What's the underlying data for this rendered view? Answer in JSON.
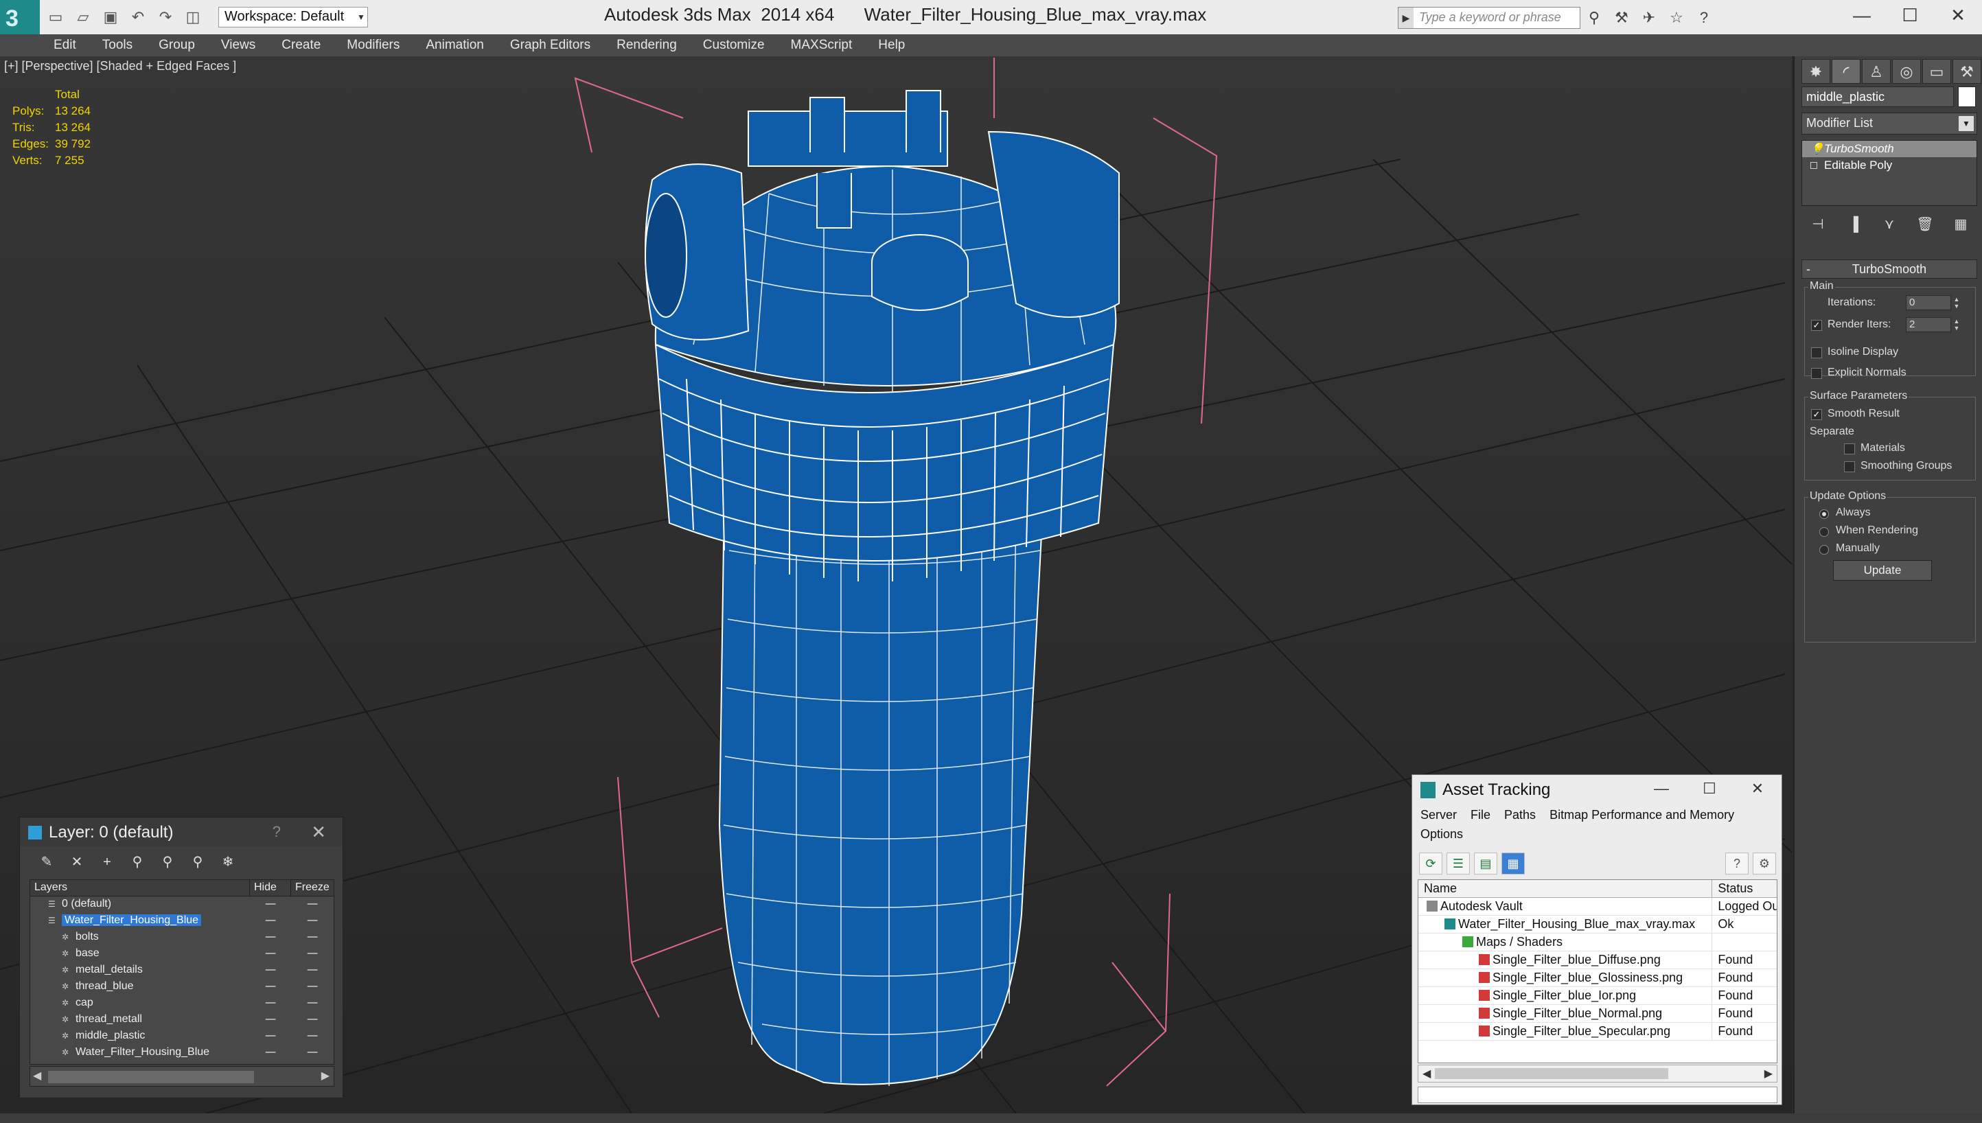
{
  "app": {
    "title": "Autodesk 3ds Max  2014 x64      Water_Filter_Housing_Blue_max_vray.max",
    "workspace_label": "Workspace: Default",
    "search_placeholder": "Type a keyword or phrase"
  },
  "menu": [
    "Edit",
    "Tools",
    "Group",
    "Views",
    "Create",
    "Modifiers",
    "Animation",
    "Graph Editors",
    "Rendering",
    "Customize",
    "MAXScript",
    "Help"
  ],
  "viewport": {
    "label": "[+] [Perspective] [Shaded + Edged Faces ]",
    "stats_header": "Total",
    "stats": [
      {
        "k": "Polys:",
        "v": "13 264"
      },
      {
        "k": "Tris:",
        "v": "13 264"
      },
      {
        "k": "Edges:",
        "v": "39 792"
      },
      {
        "k": "Verts:",
        "v": "7 255"
      }
    ]
  },
  "command_panel": {
    "object_name": "middle_plastic",
    "modifier_list": "Modifier List",
    "stack": [
      {
        "label": "TurboSmooth",
        "selected": true
      },
      {
        "label": "Editable Poly",
        "selected": false
      }
    ],
    "rollout_title": "TurboSmooth",
    "main_label": "Main",
    "iterations_label": "Iterations:",
    "iterations_value": "0",
    "render_iters_label": "Render Iters:",
    "render_iters_value": "2",
    "isoline_label": "Isoline Display",
    "explicit_normals_label": "Explicit Normals",
    "surface_params_label": "Surface Parameters",
    "smooth_result_label": "Smooth Result",
    "separate_label": "Separate",
    "materials_label": "Materials",
    "smoothing_groups_label": "Smoothing Groups",
    "update_options_label": "Update Options",
    "always_label": "Always",
    "when_rendering_label": "When Rendering",
    "manually_label": "Manually",
    "update_button": "Update"
  },
  "layer_dialog": {
    "title": "Layer: 0 (default)",
    "help": "?",
    "columns": {
      "layers": "Layers",
      "hide": "Hide",
      "freeze": "Freeze"
    },
    "rows": [
      {
        "name": "0 (default)",
        "indent": 1,
        "selected": false
      },
      {
        "name": "Water_Filter_Housing_Blue",
        "indent": 1,
        "selected": true
      },
      {
        "name": "bolts",
        "indent": 2,
        "selected": false
      },
      {
        "name": "base",
        "indent": 2,
        "selected": false
      },
      {
        "name": "metall_details",
        "indent": 2,
        "selected": false
      },
      {
        "name": "thread_blue",
        "indent": 2,
        "selected": false
      },
      {
        "name": "cap",
        "indent": 2,
        "selected": false
      },
      {
        "name": "thread_metall",
        "indent": 2,
        "selected": false
      },
      {
        "name": "middle_plastic",
        "indent": 2,
        "selected": false
      },
      {
        "name": "Water_Filter_Housing_Blue",
        "indent": 2,
        "selected": false
      }
    ]
  },
  "asset_tracking": {
    "title": "Asset Tracking",
    "menu": [
      "Server",
      "File",
      "Paths",
      "Bitmap Performance and Memory"
    ],
    "menu2": "Options",
    "columns": {
      "name": "Name",
      "status": "Status"
    },
    "rows": [
      {
        "name": "Autodesk Vault",
        "status": "Logged Ou",
        "indent": 0,
        "icon": "vault-icon"
      },
      {
        "name": "Water_Filter_Housing_Blue_max_vray.max",
        "status": "Ok",
        "indent": 1,
        "icon": "max-file-icon"
      },
      {
        "name": "Maps / Shaders",
        "status": "",
        "indent": 2,
        "icon": "maps-icon"
      },
      {
        "name": "Single_Filter_blue_Diffuse.png",
        "status": "Found",
        "indent": 3,
        "icon": "png-icon"
      },
      {
        "name": "Single_Filter_blue_Glossiness.png",
        "status": "Found",
        "indent": 3,
        "icon": "png-icon"
      },
      {
        "name": "Single_Filter_blue_Ior.png",
        "status": "Found",
        "indent": 3,
        "icon": "png-icon"
      },
      {
        "name": "Single_Filter_blue_Normal.png",
        "status": "Found",
        "indent": 3,
        "icon": "png-icon"
      },
      {
        "name": "Single_Filter_blue_Specular.png",
        "status": "Found",
        "indent": 3,
        "icon": "png-icon"
      }
    ]
  },
  "colors": {
    "model_blue": "#0f5ca8",
    "wire": "#ffffff",
    "stats_yellow": "#f0d400",
    "selection_blue": "#2e78d6",
    "bbox_pink": "#e06a8a"
  }
}
